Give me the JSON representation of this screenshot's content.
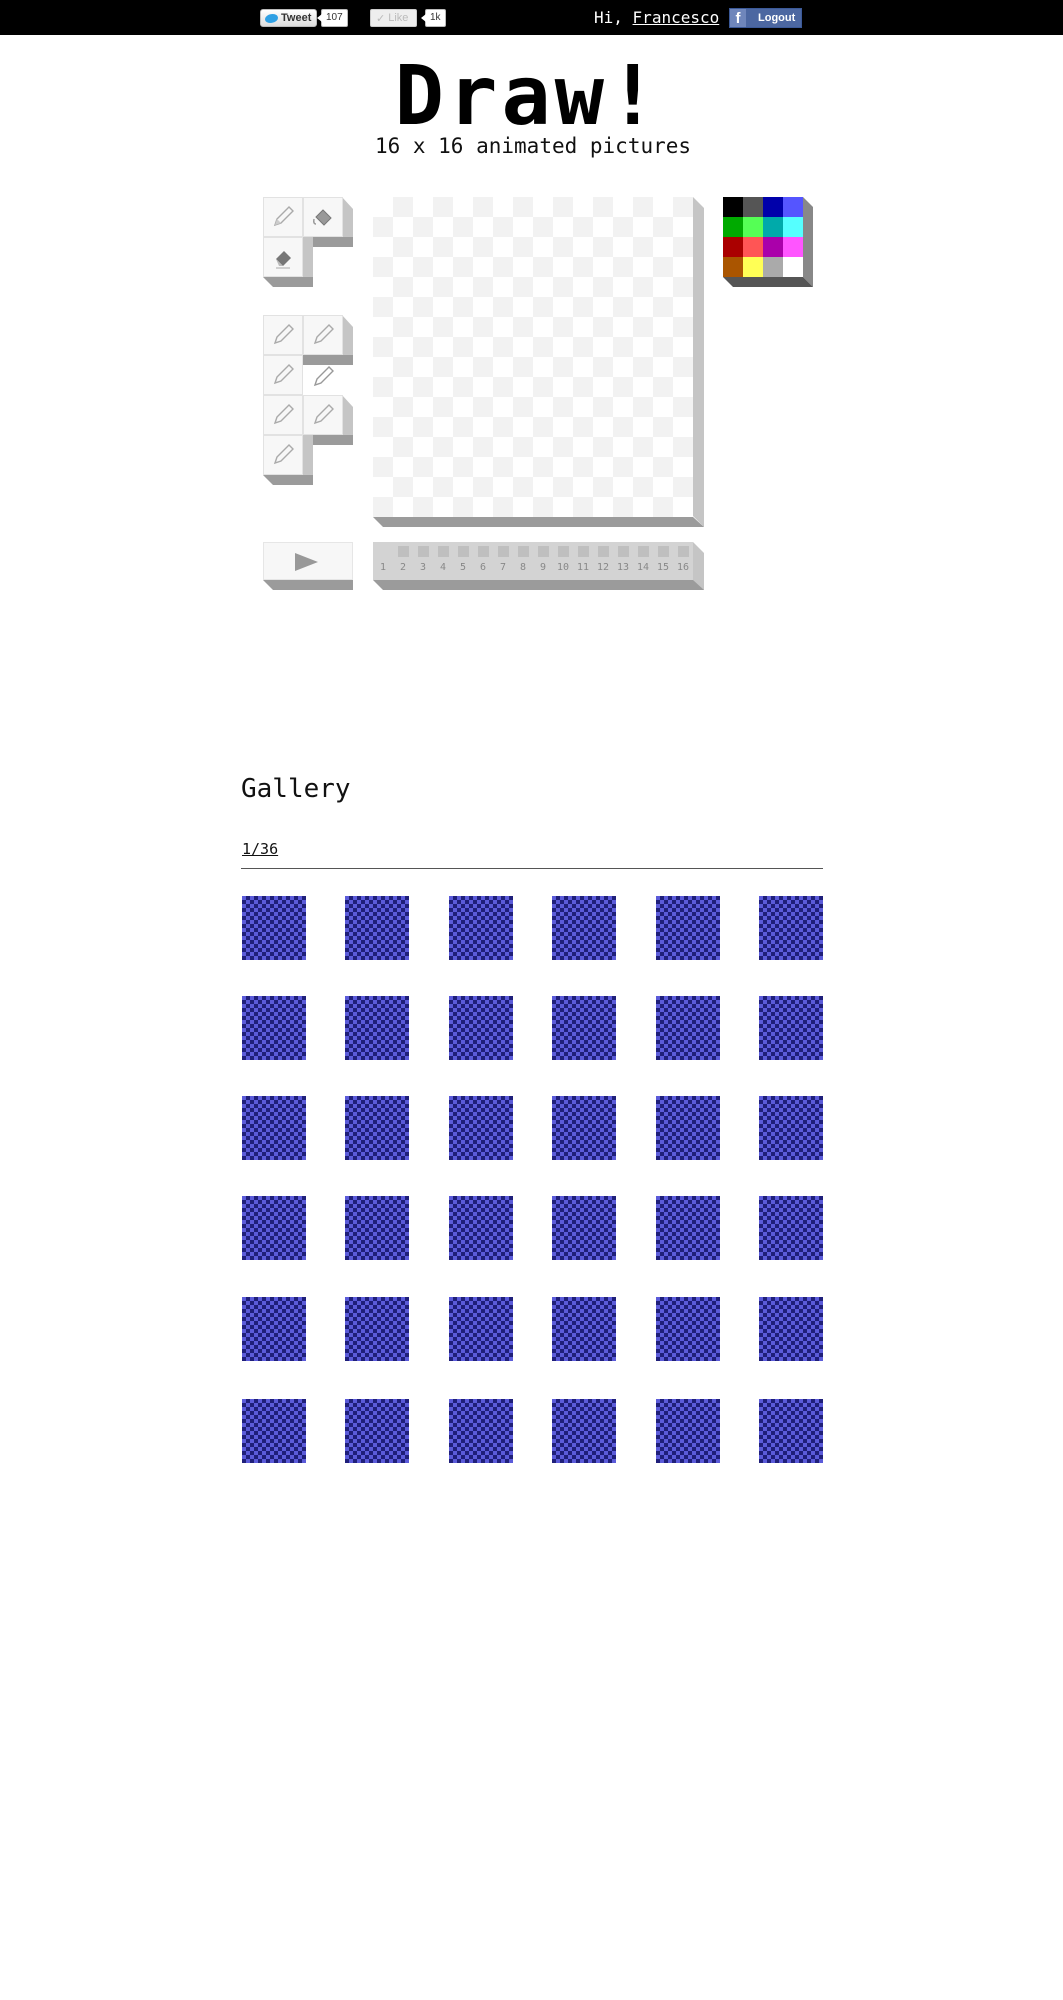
{
  "header": {
    "tweet_label": "Tweet",
    "tweet_count": "107",
    "like_label": "Like",
    "like_count": "1k",
    "greeting": "Hi,",
    "username": "Francesco",
    "logout_label": "Logout",
    "facebook_glyph": "f"
  },
  "app": {
    "title": "Draw!",
    "subtitle": "16 x 16 animated pictures"
  },
  "tools": [
    {
      "name": "pencil-tool",
      "icon": "pencil-icon"
    },
    {
      "name": "fill-tool",
      "icon": "paint-bucket-icon"
    },
    {
      "name": "eraser-tool",
      "icon": "eraser-icon"
    }
  ],
  "brushes": [
    "brush-1",
    "brush-2",
    "brush-3",
    "brush-4",
    "brush-5",
    "brush-6",
    "brush-7"
  ],
  "palette": {
    "colors": [
      "#000000",
      "#555555",
      "#0000aa",
      "#5555ff",
      "#00aa00",
      "#55ff55",
      "#00aaaa",
      "#55ffff",
      "#aa0000",
      "#ff5555",
      "#aa00aa",
      "#ff55ff",
      "#aa5500",
      "#ffff55",
      "#aaaaaa",
      "#ffffff"
    ]
  },
  "frames": [
    "1",
    "2",
    "3",
    "4",
    "5",
    "6",
    "7",
    "8",
    "9",
    "10",
    "11",
    "12",
    "13",
    "14",
    "15",
    "16"
  ],
  "play_icon": "play-icon",
  "gallery": {
    "title": "Gallery",
    "page": "1/36",
    "thumbnail_count": 36,
    "thumbnail_colors": [
      "#5b5bd9",
      "#1f1f7a"
    ]
  }
}
